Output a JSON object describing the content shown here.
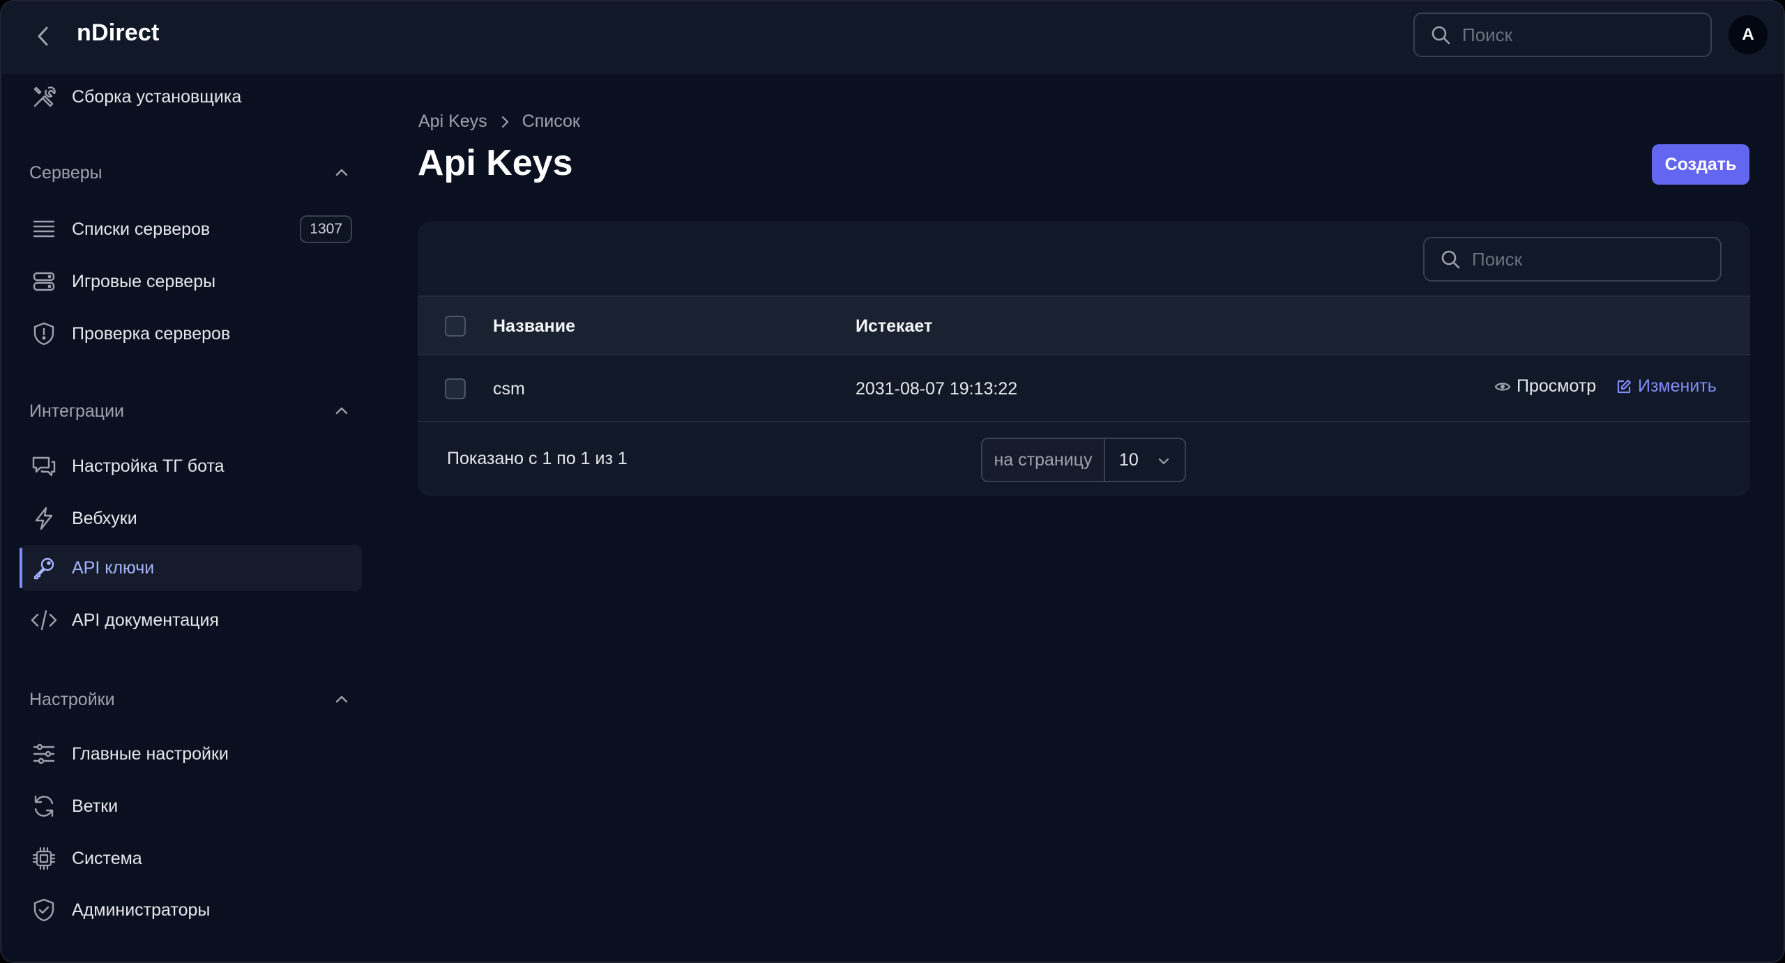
{
  "app": {
    "name": "nDirect"
  },
  "header": {
    "search_placeholder": "Поиск",
    "avatar_initial": "A"
  },
  "sidebar": {
    "top_item": {
      "label": "Сборка установщика",
      "icon": "tools-icon"
    },
    "groups": [
      {
        "title": "Серверы",
        "items": [
          {
            "label": "Списки серверов",
            "icon": "list-icon",
            "badge": "1307"
          },
          {
            "label": "Игровые серверы",
            "icon": "server-icon"
          },
          {
            "label": "Проверка серверов",
            "icon": "shield-alert-icon"
          }
        ]
      },
      {
        "title": "Интеграции",
        "items": [
          {
            "label": "Настройка ТГ бота",
            "icon": "chat-icon"
          },
          {
            "label": "Вебхуки",
            "icon": "bolt-icon"
          },
          {
            "label": "API ключи",
            "icon": "key-icon",
            "active": true
          },
          {
            "label": "API документация",
            "icon": "code-icon"
          }
        ]
      },
      {
        "title": "Настройки",
        "items": [
          {
            "label": "Главные настройки",
            "icon": "sliders-icon"
          },
          {
            "label": "Ветки",
            "icon": "refresh-icon"
          },
          {
            "label": "Система",
            "icon": "cpu-icon"
          },
          {
            "label": "Администраторы",
            "icon": "shield-check-icon"
          }
        ]
      }
    ]
  },
  "main": {
    "breadcrumb": [
      "Api Keys",
      "Список"
    ],
    "title": "Api Keys",
    "create_label": "Создать",
    "table": {
      "search_placeholder": "Поиск",
      "columns": [
        "Название",
        "Истекает"
      ],
      "rows": [
        {
          "name": "csm",
          "expires": "2031-08-07 19:13:22"
        }
      ],
      "actions": {
        "view": "Просмотр",
        "edit": "Изменить"
      },
      "footer": {
        "shown": "Показано с 1 по 1 из 1",
        "per_page_label": "на страницу",
        "per_page_value": "10"
      }
    }
  },
  "colors": {
    "accent": "#6366f1",
    "accent_text": "#818cf8",
    "background": "#0b1020",
    "panel": "#111827"
  }
}
